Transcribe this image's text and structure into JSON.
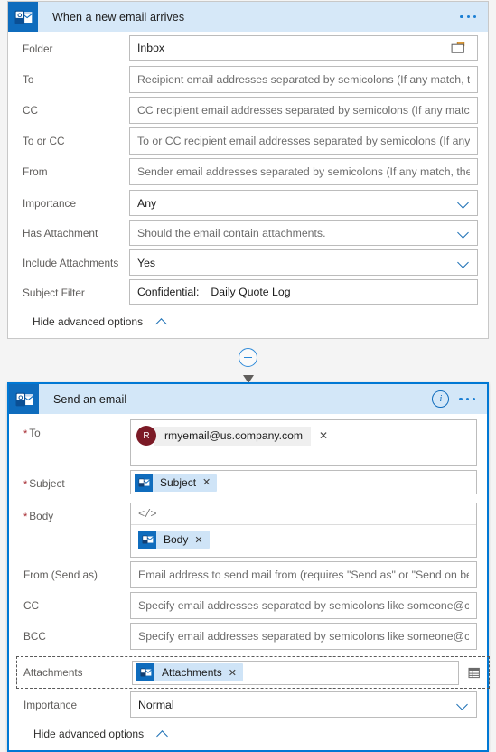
{
  "colors": {
    "accent": "#0f6cbd",
    "header_bg": "#d6e8f8",
    "selected_border": "#0078d4",
    "token_bg": "#cfe4f7",
    "avatar_bg": "#7b1a26",
    "required_star": "#a4262c",
    "connector": "#2b88d8"
  },
  "trigger_card": {
    "icon": "outlook-icon",
    "title": "When a new email arrives",
    "overflow_menu": "...",
    "fields": [
      {
        "label": "Folder",
        "type": "text-with-picker",
        "value": "Inbox",
        "picker_icon": "folder-icon"
      },
      {
        "label": "To",
        "type": "text",
        "placeholder": "Recipient email addresses separated by semicolons (If any match, th"
      },
      {
        "label": "CC",
        "type": "text",
        "placeholder": "CC recipient email addresses separated by semicolons (If any match"
      },
      {
        "label": "To or CC",
        "type": "text",
        "placeholder": "To or CC recipient email addresses separated by semicolons (If any "
      },
      {
        "label": "From",
        "type": "text",
        "placeholder": "Sender email addresses separated by semicolons (If any match, the"
      },
      {
        "label": "Importance",
        "type": "dropdown",
        "value": "Any"
      },
      {
        "label": "Has Attachment",
        "type": "dropdown",
        "placeholder": "Should the email contain attachments."
      },
      {
        "label": "Include Attachments",
        "type": "dropdown",
        "value": "Yes"
      }
    ],
    "subject_filter": {
      "label": "Subject Filter",
      "value_part1": "Confidential:",
      "value_part2": "Daily Quote Log"
    },
    "advanced_toggle": {
      "label": "Hide advanced options",
      "icon": "chevron-up-icon"
    }
  },
  "connector": {
    "add_icon": "plus-circle-icon",
    "arrow_icon": "arrow-down-icon"
  },
  "action_card": {
    "icon": "outlook-icon",
    "title": "Send an email",
    "info_icon": "info-icon",
    "overflow_menu": "...",
    "to_field": {
      "label": "To",
      "required": true,
      "person": {
        "initial": "R",
        "email": "rmyemail@us.company.com",
        "remove_icon": "close-icon"
      }
    },
    "subject_field": {
      "label": "Subject",
      "required": true,
      "token": {
        "icon": "outlook-token-icon",
        "text": "Subject",
        "remove_icon": "close-icon"
      }
    },
    "body_field": {
      "label": "Body",
      "required": true,
      "toolbar_icon": "code-view-icon",
      "token": {
        "icon": "outlook-token-icon",
        "text": "Body",
        "remove_icon": "close-icon"
      }
    },
    "fields": [
      {
        "label": "From (Send as)",
        "label_sub": "(Send as)",
        "type": "text",
        "placeholder": "Email address to send mail from (requires \"Send as\" or \"Send on be"
      },
      {
        "label": "CC",
        "type": "text",
        "placeholder": "Specify email addresses separated by semicolons like someone@cc"
      },
      {
        "label": "BCC",
        "type": "text",
        "placeholder": "Specify email addresses separated by semicolons like someone@cc"
      }
    ],
    "attachments_field": {
      "label": "Attachments",
      "token": {
        "icon": "outlook-token-icon",
        "text": "Attachments",
        "remove_icon": "close-icon"
      },
      "array_icon": "switch-to-array-icon"
    },
    "importance_field": {
      "label": "Importance",
      "value": "Normal",
      "icon": "chevron-down-icon"
    },
    "advanced_toggle": {
      "label": "Hide advanced options",
      "icon": "chevron-up-icon"
    }
  }
}
